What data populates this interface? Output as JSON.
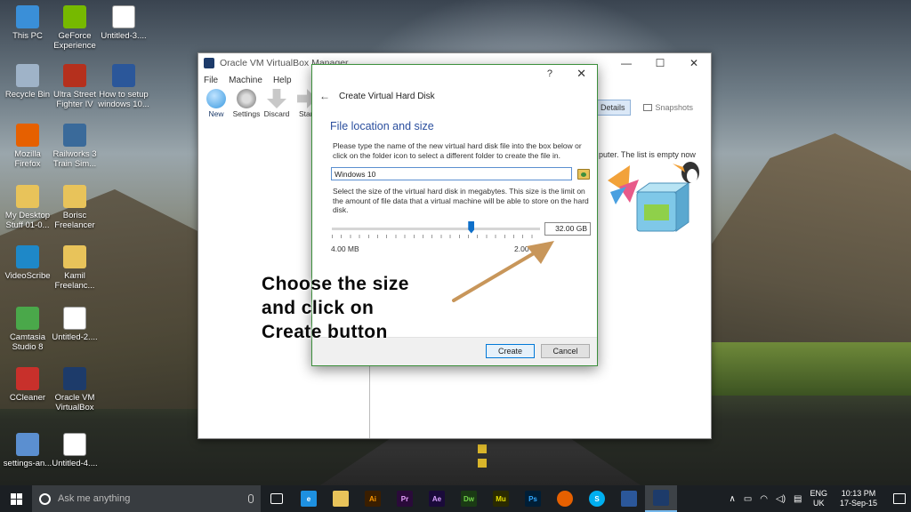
{
  "desktop": {
    "icons": [
      {
        "label": "This PC",
        "icon": "this-pc-icon",
        "color": "#3a8fd8"
      },
      {
        "label": "GeForce Experience",
        "icon": "geforce-icon",
        "color": "#76b900"
      },
      {
        "label": "Untitled-3....",
        "icon": "untitled-file-icon",
        "color": "#ffffff"
      },
      {
        "label": "Recycle Bin",
        "icon": "recycle-bin-icon",
        "color": "#9fb3c8"
      },
      {
        "label": "Ultra Street Fighter IV",
        "icon": "street-fighter-icon",
        "color": "#b5301d"
      },
      {
        "label": "How to setup windows 10...",
        "icon": "document-icon",
        "color": "#2b579a"
      },
      {
        "label": "Mozilla Firefox",
        "icon": "firefox-icon",
        "color": "#e66000"
      },
      {
        "label": "Railworks 3 Train Sim...",
        "icon": "railworks-icon",
        "color": "#3a6a9a"
      },
      {
        "label": "My Desktop Stuff 01-0...",
        "icon": "folder-icon",
        "color": "#e8c35a"
      },
      {
        "label": "Borisc Freelancer",
        "icon": "folder-icon",
        "color": "#e8c35a"
      },
      {
        "label": "VideoScribe",
        "icon": "videoscribe-icon",
        "color": "#1e88c8"
      },
      {
        "label": "Kamil Freelanc...",
        "icon": "folder-icon",
        "color": "#e8c35a"
      },
      {
        "label": "Camtasia Studio 8",
        "icon": "camtasia-icon",
        "color": "#4aa84a"
      },
      {
        "label": "Untitled-2....",
        "icon": "untitled-file-icon",
        "color": "#ffffff"
      },
      {
        "label": "CCleaner",
        "icon": "ccleaner-icon",
        "color": "#c8302b"
      },
      {
        "label": "Oracle VM VirtualBox",
        "icon": "virtualbox-icon",
        "color": "#1d3b6a"
      },
      {
        "label": "settings-an...",
        "icon": "image-file-icon",
        "color": "#5b8fd0"
      },
      {
        "label": "Untitled-4....",
        "icon": "untitled-file-icon",
        "color": "#ffffff"
      }
    ]
  },
  "vbox": {
    "title": "Oracle VM VirtualBox Manager",
    "menu": [
      "File",
      "Machine",
      "Help"
    ],
    "toolbar": [
      {
        "label": "New",
        "color": "#3a9ae0"
      },
      {
        "label": "Settings",
        "color": "#9a9a9a"
      },
      {
        "label": "Discard",
        "color": "#b0b0b0"
      },
      {
        "label": "Start",
        "color": "#b0b0b0"
      }
    ],
    "tabs": {
      "details": "Details",
      "snapshots": "Snapshots"
    },
    "empty_message": "puter. The list is empty now",
    "window_buttons": {
      "minimize": "—",
      "maximize": "☐",
      "close": "✕"
    }
  },
  "dialog": {
    "help": "?",
    "close": "✕",
    "title": "Create Virtual Hard Disk",
    "section_title": "File location and size",
    "instruction": "Please type the name of the new virtual hard disk file into the box below or click on the folder icon to select a different folder to create the file in.",
    "file_name": "Windows 10",
    "size_instruction": "Select the size of the virtual hard disk in megabytes. This size is the limit on the amount of file data that a virtual machine will be able to store on the hard disk.",
    "size_value": "32.00 GB",
    "slider_fraction": 0.67,
    "min_label": "4.00 MB",
    "max_label": "2.00 TB",
    "create_label": "Create",
    "cancel_label": "Cancel"
  },
  "annotation": {
    "line1": "Choose the size",
    "line2": "and click on",
    "line3": "Create button",
    "arrow_color": "#c8965a"
  },
  "taskbar": {
    "search_placeholder": "Ask me anything",
    "apps": [
      {
        "name": "task-view-icon",
        "label": "",
        "color": "#1b1f23"
      },
      {
        "name": "edge-icon",
        "label": "e",
        "color": "#1e90e0"
      },
      {
        "name": "file-explorer-icon",
        "label": "",
        "color": "#e8c35a"
      },
      {
        "name": "illustrator-icon",
        "label": "Ai",
        "color": "#3a1e00"
      },
      {
        "name": "premiere-icon",
        "label": "Pr",
        "color": "#2a0a3a"
      },
      {
        "name": "after-effects-icon",
        "label": "Ae",
        "color": "#1a0a3a"
      },
      {
        "name": "dreamweaver-icon",
        "label": "Dw",
        "color": "#1a3a14"
      },
      {
        "name": "muse-icon",
        "label": "Mu",
        "color": "#2a2a00"
      },
      {
        "name": "photoshop-icon",
        "label": "Ps",
        "color": "#001e36"
      },
      {
        "name": "firefox-icon",
        "label": "",
        "color": "#e66000"
      },
      {
        "name": "skype-icon",
        "label": "S",
        "color": "#00aff0"
      },
      {
        "name": "word-doc-icon",
        "label": "",
        "color": "#2b579a"
      },
      {
        "name": "virtualbox-icon",
        "label": "",
        "color": "#1d3b6a"
      }
    ],
    "language": "ENG",
    "region": "UK",
    "time": "10:13 PM",
    "date": "17-Sep-15"
  }
}
